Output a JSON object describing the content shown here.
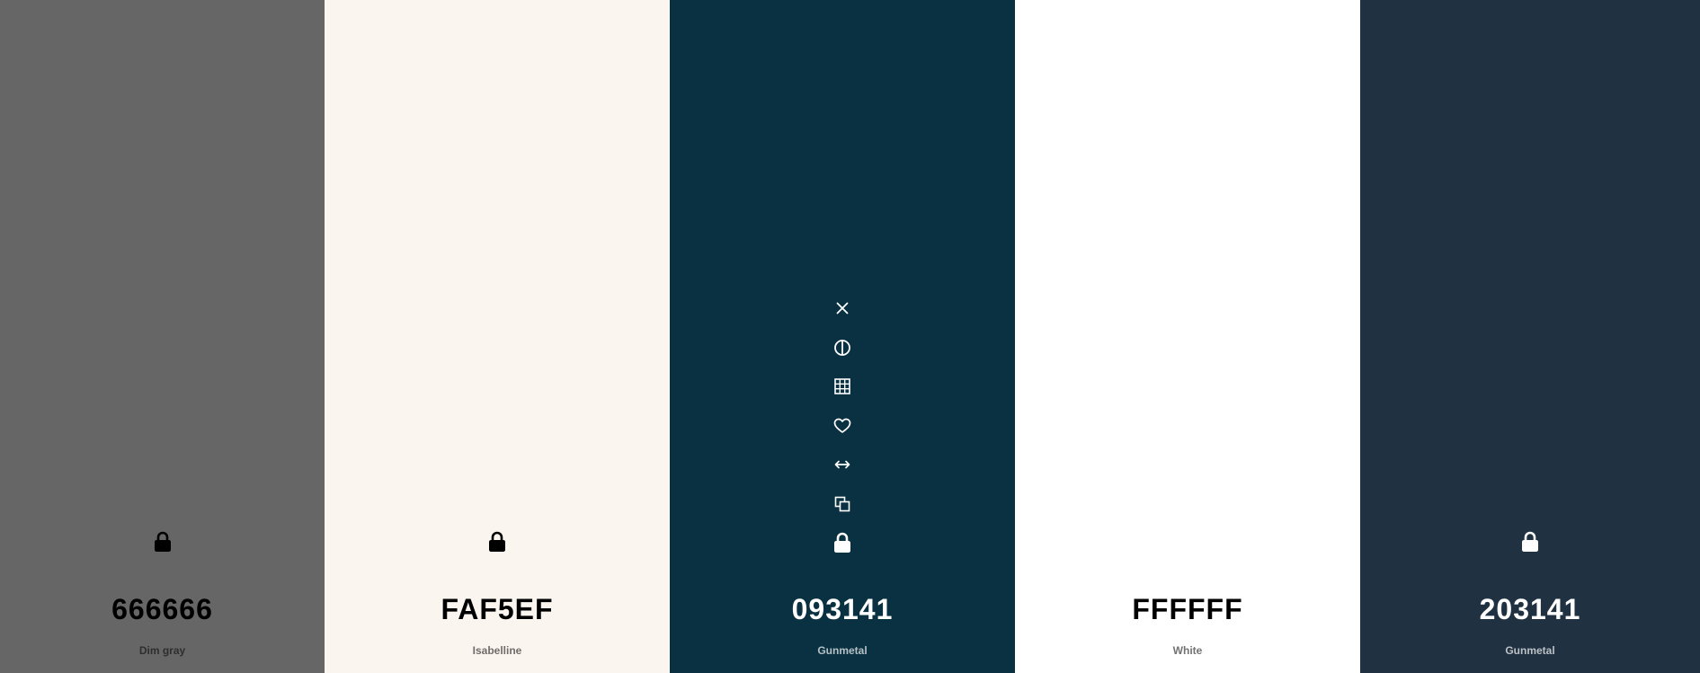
{
  "swatches": [
    {
      "hex": "666666",
      "name": "Dim gray",
      "background": "#666666",
      "text_color": "#000000",
      "name_color": "#2e2e2e",
      "icon_color": "#000000",
      "lock_icon": "lock-icon",
      "show_lock": true
    },
    {
      "hex": "FAF5EF",
      "name": "Isabelline",
      "background": "#FAF5EF",
      "text_color": "#000000",
      "name_color": "#6f6c69",
      "icon_color": "#000000",
      "lock_icon": "lock-icon",
      "show_lock": true
    },
    {
      "hex": "093141",
      "name": "Gunmetal",
      "background": "#093141",
      "text_color": "#ffffff",
      "name_color": "#b5c1c6",
      "icon_color": "#ffffff",
      "lock_icon": "lock-icon",
      "show_lock": true,
      "hovered": true
    },
    {
      "hex": "FFFFFF",
      "name": "White",
      "background": "#FFFFFF",
      "text_color": "#000000",
      "name_color": "#727272",
      "icon_color": "#000000",
      "lock_icon": "lock-icon",
      "show_lock": false
    },
    {
      "hex": "203141",
      "name": "Gunmetal",
      "background": "#203141",
      "text_color": "#ffffff",
      "name_color": "#bcc1c6",
      "icon_color": "#ffffff",
      "lock_icon": "lock-icon",
      "show_lock": true
    }
  ],
  "hover_tools": [
    {
      "name": "remove",
      "icon": "close-icon"
    },
    {
      "name": "shades",
      "icon": "contrast-icon"
    },
    {
      "name": "view-shades",
      "icon": "grid-icon"
    },
    {
      "name": "save",
      "icon": "heart-icon"
    },
    {
      "name": "drag",
      "icon": "move-horizontal-icon"
    },
    {
      "name": "copy",
      "icon": "copy-icon"
    },
    {
      "name": "lock",
      "icon": "lock-icon"
    }
  ]
}
